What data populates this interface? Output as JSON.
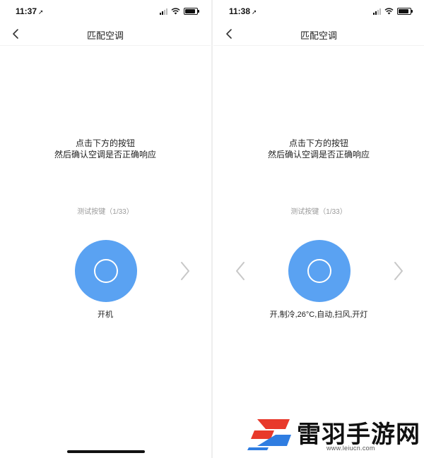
{
  "left_screen": {
    "status": {
      "time": "11:37"
    },
    "nav": {
      "title": "匹配空调"
    },
    "instruction": {
      "line1": "点击下方的按钮",
      "line2": "然后确认空调是否正确响应"
    },
    "counter": "测试按键（1/33）",
    "button_label": "开机"
  },
  "right_screen": {
    "status": {
      "time": "11:38"
    },
    "nav": {
      "title": "匹配空调"
    },
    "instruction": {
      "line1": "点击下方的按钮",
      "line2": "然后确认空调是否正确响应"
    },
    "counter": "测试按键（1/33）",
    "button_label": "开,制冷,26°C,自动,扫风,开灯"
  },
  "watermark": {
    "brand": "雷羽手游网",
    "url": "www.leiucn.com"
  },
  "icons": {
    "status": [
      "location-arrow-icon",
      "signal-icon",
      "wifi-icon",
      "battery-icon"
    ],
    "nav": "back-chevron-icon",
    "test_button": "power-ring-icon",
    "arrows": [
      "chevron-left-icon",
      "chevron-right-icon"
    ]
  },
  "colors": {
    "accent": "#5aa2f2",
    "arrow": "#c8c8c8",
    "secondary_text": "#9a9a9a",
    "primary_text": "#222222"
  }
}
